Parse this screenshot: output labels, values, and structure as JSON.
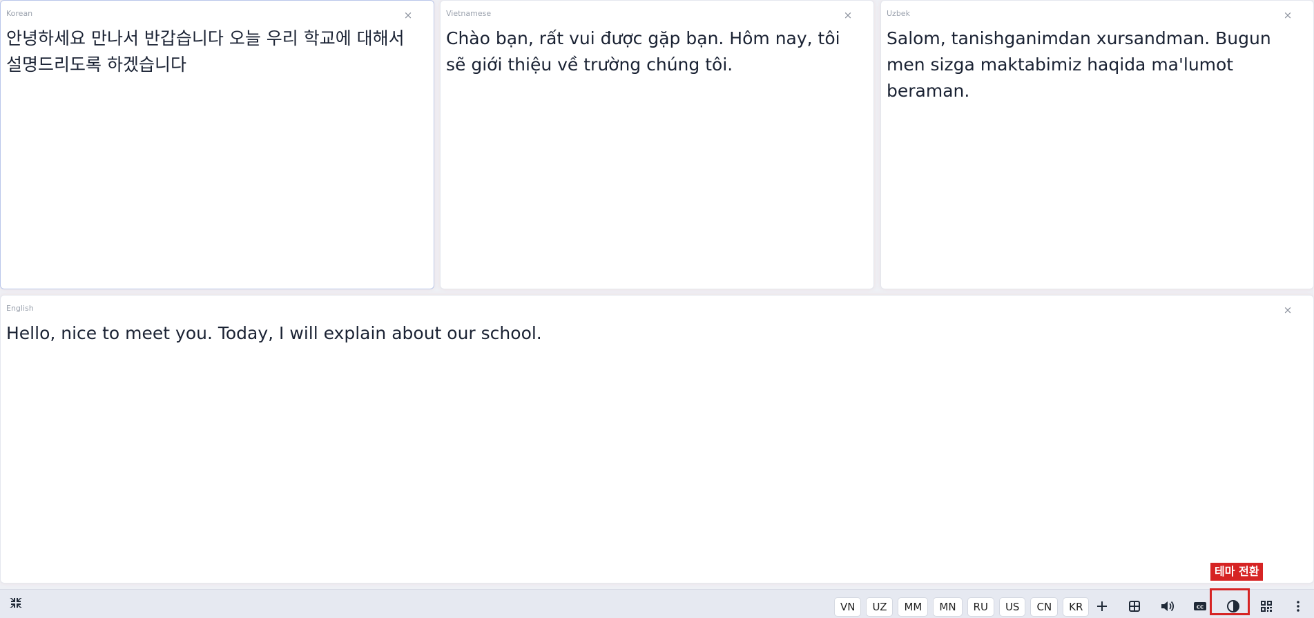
{
  "panels": {
    "korean": {
      "lang": "Korean",
      "text": "안녕하세요 만나서 반갑습니다 오늘 우리 학교에 대해서 설명드리도록 하겠습니다"
    },
    "vietnamese": {
      "lang": "Vietnamese",
      "text": "Chào bạn, rất vui được gặp bạn. Hôm nay, tôi sẽ giới thiệu về trường chúng tôi."
    },
    "uzbek": {
      "lang": "Uzbek",
      "text": "Salom, tanishganimdan xursandman. Bugun men sizga maktabimiz haqida ma'lumot beraman."
    },
    "english": {
      "lang": "English",
      "text": "Hello, nice to meet you. Today, I will explain about our school."
    },
    "close_glyph": "×"
  },
  "toolbar": {
    "languages": [
      "VN",
      "UZ",
      "MM",
      "MN",
      "RU",
      "US",
      "CN",
      "KR"
    ],
    "icons": [
      "collapse-icon",
      "plus-icon",
      "grid-icon",
      "volume-icon",
      "closed-caption-icon",
      "theme-toggle-icon",
      "qr-code-icon",
      "more-vertical-icon"
    ]
  },
  "tooltip": {
    "text": "테마 전환",
    "color": "#d62424"
  },
  "colors": {
    "background": "#eef0f5",
    "panel": "#ffffff",
    "active_border": "#b9c6ea",
    "toolbar": "#e6e9f1"
  }
}
